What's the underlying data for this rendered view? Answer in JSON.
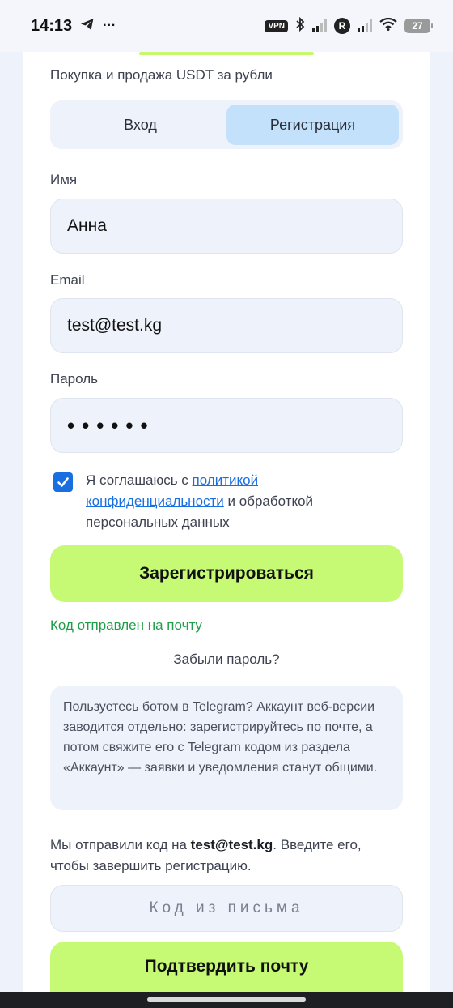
{
  "status_bar": {
    "time": "14:13",
    "telegram_icon": "telegram-send-icon",
    "more": "···",
    "vpn": "VPN",
    "r_badge": "R",
    "battery": "27"
  },
  "form": {
    "subtitle": "Покупка и продажа USDT за рубли",
    "tabs": [
      {
        "label": "Вход",
        "active": false
      },
      {
        "label": "Регистрация",
        "active": true
      }
    ],
    "name_label": "Имя",
    "name_value": "Анна",
    "email_label": "Email",
    "email_value": "test@test.kg",
    "password_label": "Пароль",
    "password_value": "••••••",
    "consent": {
      "checked": true,
      "prefix": "Я соглашаюсь с ",
      "link": "политикой конфиденциальности",
      "suffix": " и обработкой персональных данных"
    },
    "register_button": "Зарегистрироваться",
    "sent_message": "Код отправлен на почту",
    "forgot_password": "Забыли пароль?",
    "info_text": "Пользуетесь ботом в Telegram? Аккаунт веб-версии заводится отдельно: зарегистрируйтесь по почте, а потом свяжите его с Telegram кодом из раздела «Аккаунт» — заявки и уведомления станут общими.",
    "code_note_prefix": "Мы отправили код на ",
    "code_note_email": "test@test.kg",
    "code_note_suffix": ". Введите его, чтобы завершить регистрацию.",
    "code_placeholder": "Код из письма",
    "confirm_button": "Подтвердить почту"
  },
  "colors": {
    "accent_green": "#c6fa74",
    "active_tab": "#c3e1fb",
    "link_blue": "#1a6fe0",
    "success_green": "#1f9d4a"
  }
}
